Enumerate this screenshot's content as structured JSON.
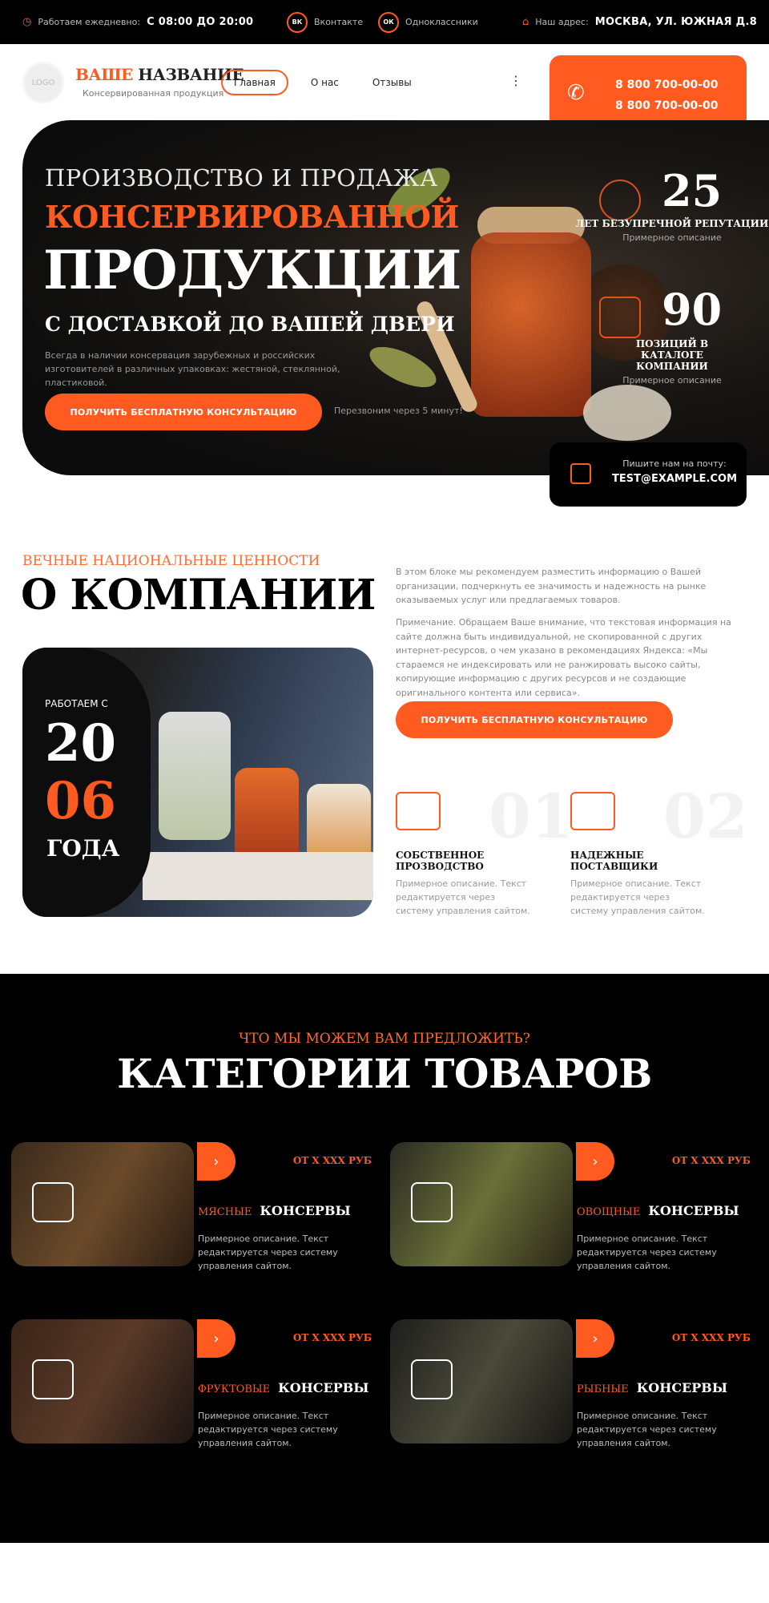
{
  "topbar": {
    "hours_label": "Работаем ежедневно:",
    "hours_value": "С 08:00 ДО 20:00",
    "vk_icon": "ВК",
    "vk_label": "Вконтакте",
    "ok_icon": "ОК",
    "ok_label": "Одноклассники",
    "address_label": "Наш адрес:",
    "address_value": "МОСКВА, УЛ. ЮЖНАЯ Д.8"
  },
  "header": {
    "logo": "LOGO",
    "brand_accent": "ВАШЕ",
    "brand_rest": "НАЗВАНИЕ",
    "brand_sub": "Консервированная продукция",
    "nav": [
      "Главная",
      "О нас",
      "Отзывы"
    ],
    "more": "⋮",
    "phone1": "8 800 700-00-00",
    "phone2": "8 800 700-00-00"
  },
  "hero": {
    "line1": "ПРОИЗВОДСТВО И ПРОДАЖА",
    "line2": "КОНСЕРВИРОВАННОЙ",
    "line3": "ПРОДУКЦИИ",
    "line4": "С ДОСТАВКОЙ ДО ВАШЕЙ ДВЕРИ",
    "desc": "Всегда в наличии консервация зарубежных и российских изготовителей в различных упаковках: жестяной, стеклянной, пластиковой.",
    "cta": "ПОЛУЧИТЬ БЕСПЛАТНУЮ КОНСУЛЬТАЦИЮ",
    "cta_note": "Перезвоним через 5 минут!",
    "stats": [
      {
        "num": "25",
        "title": "ЛЕТ БЕЗУПРЕЧНОЙ РЕПУТАЦИИ",
        "desc": "Примерное описание"
      },
      {
        "num": "90",
        "title": "ПОЗИЦИЙ В КАТАЛОГЕ КОМПАНИИ",
        "desc": "Примерное описание"
      }
    ],
    "email_label": "Пишите нам на почту:",
    "email_value": "TEST@EXAMPLE.COM"
  },
  "about": {
    "pre": "ВЕЧНЫЕ НАЦИОНАЛЬНЫЕ ЦЕННОСТИ",
    "title": "О КОМПАНИИ",
    "p1": "В этом блоке мы рекомендуем разместить информацию о Вашей организации, подчеркнуть ее значимость и надежность на рынке оказываемых услуг или предлагаемых товаров.",
    "p2": "Примечание. Обращаем Ваше внимание, что текстовая информация на сайте должна быть индивидуальной, не скопированной с других интернет-ресурсов, о чем указано в рекомендациях Яндекса: «Мы стараемся не индексировать или не ранжировать высоко сайты, копирующие информацию с других ресурсов и не создающие оригинального контента или сервиса».",
    "cta": "ПОЛУЧИТЬ БЕСПЛАТНУЮ КОНСУЛЬТАЦИЮ",
    "since_label": "РАБОТАЕМ С",
    "year1": "20",
    "year2": "06",
    "years_word": "ГОДА",
    "features": [
      {
        "num": "01",
        "title": "СОБСТВЕННОЕ ПРОЗВОДСТВО",
        "desc": "Примерное описание. Текст редактируется через систему управления сайтом."
      },
      {
        "num": "02",
        "title": "НАДЕЖНЫЕ ПОСТАВЩИКИ",
        "desc": "Примерное описание. Текст редактируется через систему управления сайтом."
      }
    ]
  },
  "categories": {
    "pre": "ЧТО МЫ МОЖЕМ ВАМ ПРЕДЛОЖИТЬ?",
    "title": "КАТЕГОРИИ ТОВАРОВ",
    "items": [
      {
        "accent": "МЯСНЫЕ",
        "name": "КОНСЕРВЫ",
        "price": "ОТ Х ХХХ РУБ",
        "desc": "Примерное описание. Текст редактируется через систему управления сайтом.",
        "arrow": "›"
      },
      {
        "accent": "ОВОЩНЫЕ",
        "name": "КОНСЕРВЫ",
        "price": "ОТ Х ХХХ РУБ",
        "desc": "Примерное описание. Текст редактируется через систему управления сайтом.",
        "arrow": "›"
      },
      {
        "accent": "ФРУКТОВЫЕ",
        "name": "КОНСЕРВЫ",
        "price": "ОТ Х ХХХ РУБ",
        "desc": "Примерное описание. Текст редактируется через систему управления сайтом.",
        "arrow": "›"
      },
      {
        "accent": "РЫБНЫЕ",
        "name": "КОНСЕРВЫ",
        "price": "ОТ Х ХХХ РУБ",
        "desc": "Примерное описание. Текст редактируется через систему управления сайтом.",
        "arrow": "›"
      }
    ]
  },
  "colors": {
    "accent": "#ff5a1f",
    "dark": "#000000"
  }
}
